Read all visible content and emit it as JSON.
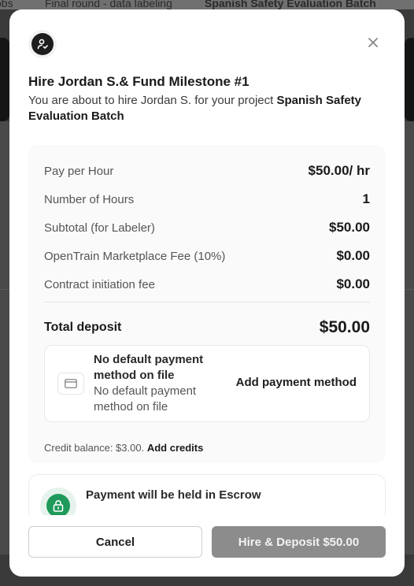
{
  "background": {
    "tabs": [
      "obs",
      "Final round - data labeling",
      "Spanish Safety Evaluation Batch"
    ]
  },
  "modal": {
    "title": "Hire Jordan S.& Fund Milestone #1",
    "subtitle_prefix": "You are about to hire Jordan S. for your project ",
    "project_name": "Spanish Safety Evaluation Batch",
    "icons": {
      "header": "user-check-icon",
      "close": "close-icon",
      "card": "credit-card-icon",
      "escrow": "lock-icon"
    },
    "summary": {
      "rows": [
        {
          "label": "Pay per Hour",
          "value": "$50.00/ hr"
        },
        {
          "label": "Number of Hours",
          "value": "1"
        },
        {
          "label": "Subtotal (for Labeler)",
          "value": "$50.00"
        },
        {
          "label": "OpenTrain Marketplace Fee (10%)",
          "value": "$0.00"
        },
        {
          "label": "Contract initiation fee",
          "value": "$0.00"
        }
      ],
      "total_label": "Total deposit",
      "total_value": "$50.00"
    },
    "payment": {
      "title": "No default payment method on file",
      "subtitle": "No default payment method on file",
      "add_button": "Add payment method"
    },
    "credit": {
      "text": "Credit balance: $3.00.",
      "add_link": "Add credits"
    },
    "escrow": {
      "title": "Payment will be held in Escrow"
    },
    "footer": {
      "cancel": "Cancel",
      "confirm": "Hire & Deposit $50.00"
    }
  },
  "colors": {
    "escrow_green": "#1f9a5a",
    "disabled_button": "#8c8c8c"
  }
}
